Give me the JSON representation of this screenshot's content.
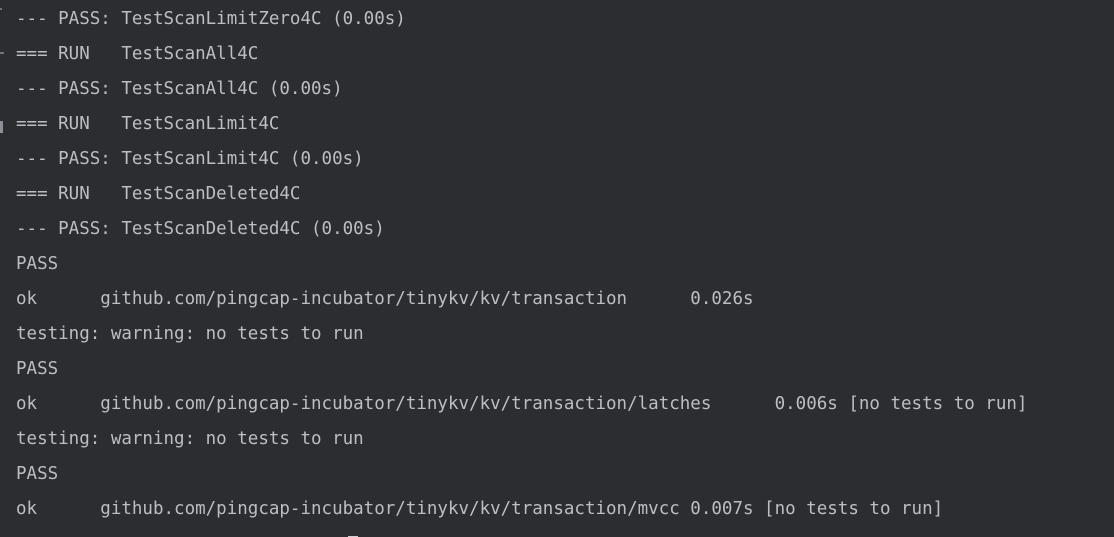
{
  "terminal": {
    "lines": [
      "--- PASS: TestScanLimitZero4C (0.00s)",
      "=== RUN   TestScanAll4C",
      "--- PASS: TestScanAll4C (0.00s)",
      "=== RUN   TestScanLimit4C",
      "--- PASS: TestScanLimit4C (0.00s)",
      "=== RUN   TestScanDeleted4C",
      "--- PASS: TestScanDeleted4C (0.00s)",
      "PASS",
      "ok  \tgithub.com/pingcap-incubator/tinykv/kv/transaction\t0.026s",
      "testing: warning: no tests to run",
      "PASS",
      "ok  \tgithub.com/pingcap-incubator/tinykv/kv/transaction/latches\t0.006s [no tests to run]",
      "testing: warning: no tests to run",
      "PASS",
      "ok  \tgithub.com/pingcap-incubator/tinykv/kv/transaction/mvcc\t0.007s [no tests to run]"
    ],
    "display_lines": [
      "--- PASS: TestScanLimitZero4C (0.00s)",
      "=== RUN   TestScanAll4C",
      "--- PASS: TestScanAll4C (0.00s)",
      "=== RUN   TestScanLimit4C",
      "--- PASS: TestScanLimit4C (0.00s)",
      "=== RUN   TestScanDeleted4C",
      "--- PASS: TestScanDeleted4C (0.00s)",
      "PASS",
      "ok      github.com/pingcap-incubator/tinykv/kv/transaction      0.026s",
      "testing: warning: no tests to run",
      "PASS",
      "ok      github.com/pingcap-incubator/tinykv/kv/transaction/latches      0.006s [no tests to run]",
      "testing: warning: no tests to run",
      "PASS",
      "ok      github.com/pingcap-incubator/tinykv/kv/transaction/mvcc 0.007s [no tests to run]"
    ],
    "text_color": "#bcbec4",
    "background_color": "#2b2d30"
  }
}
